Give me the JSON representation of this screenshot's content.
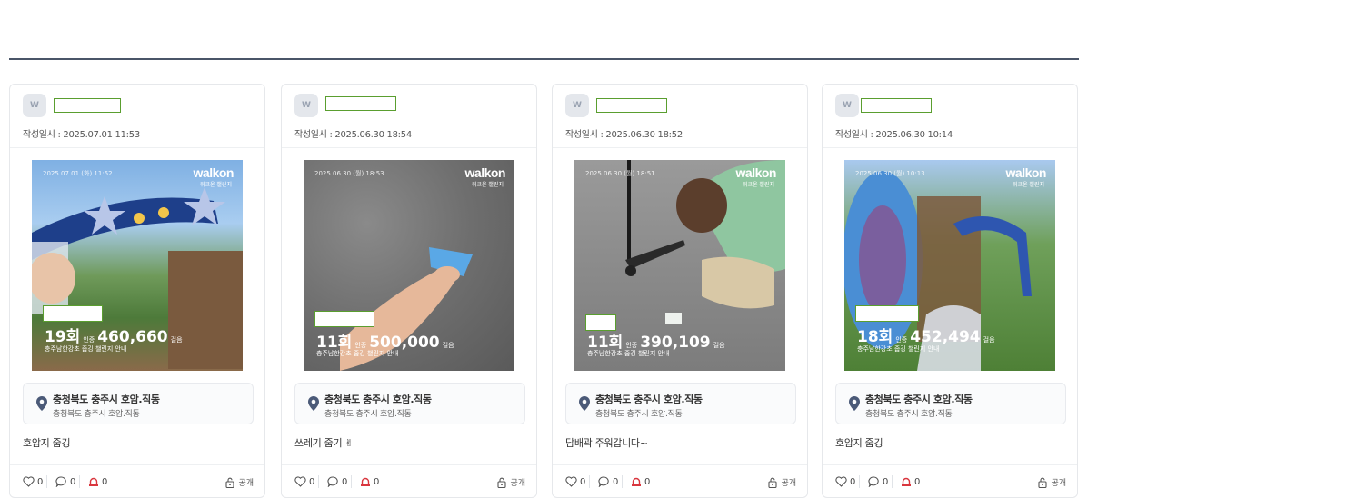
{
  "cards": [
    {
      "avatar_letter": "W",
      "date": "작성일시 : 2025.07.01 11:53",
      "photo": {
        "stamp": "2025.07.01 (화) 11:52",
        "brand": "walkon",
        "brand_sub": "워크온 챌린지",
        "count": "19회",
        "count_unit": "인증",
        "steps": "460,660",
        "steps_unit": "걸음",
        "caption": "충주남한강초 줍깅 챌린지 안내"
      },
      "location": "충청북도 충주시 호암.직동",
      "location_sub": "충청북도 충주시 호암.직동",
      "body": "호암지 줍깅",
      "likes": "0",
      "comments": "0",
      "reports": "0",
      "visibility": "공개"
    },
    {
      "avatar_letter": "W",
      "date": "작성일시 : 2025.06.30 18:54",
      "photo": {
        "stamp": "2025.06.30 (월) 18:53",
        "brand": "walkon",
        "brand_sub": "워크온 챌린지",
        "count": "11회",
        "count_unit": "인증",
        "steps": "500,000",
        "steps_unit": "걸음",
        "caption": "충주남한강초 줍깅 챌린지 안내"
      },
      "location": "충청북도 충주시 호암.직동",
      "location_sub": "충청북도 충주시 호암.직동",
      "body": "쓰레기 줍기 ✌",
      "likes": "0",
      "comments": "0",
      "reports": "0",
      "visibility": "공개"
    },
    {
      "avatar_letter": "W",
      "date": "작성일시 : 2025.06.30 18:52",
      "photo": {
        "stamp": "2025.06.30 (월) 18:51",
        "brand": "walkon",
        "brand_sub": "워크온 챌린지",
        "count": "11회",
        "count_unit": "인증",
        "steps": "390,109",
        "steps_unit": "걸음",
        "caption": "충주남한강초 줍깅 챌린지 안내"
      },
      "location": "충청북도 충주시 호암.직동",
      "location_sub": "충청북도 충주시 호암.직동",
      "body": "담배곽 주워갑니다~",
      "likes": "0",
      "comments": "0",
      "reports": "0",
      "visibility": "공개"
    },
    {
      "avatar_letter": "W",
      "date": "작성일시 : 2025.06.30 10:14",
      "photo": {
        "stamp": "2025.06.30 (월) 10:13",
        "brand": "walkon",
        "brand_sub": "워크온 챌린지",
        "count": "18회",
        "count_unit": "인증",
        "steps": "452,494",
        "steps_unit": "걸음",
        "caption": "충주남한강초 줍깅 챌린지 안내"
      },
      "location": "충청북도 충주시 호암.직동",
      "location_sub": "충청북도 충주시 호암.직동",
      "body": "호암지 줍깅",
      "likes": "0",
      "comments": "0",
      "reports": "0",
      "visibility": "공개"
    }
  ]
}
